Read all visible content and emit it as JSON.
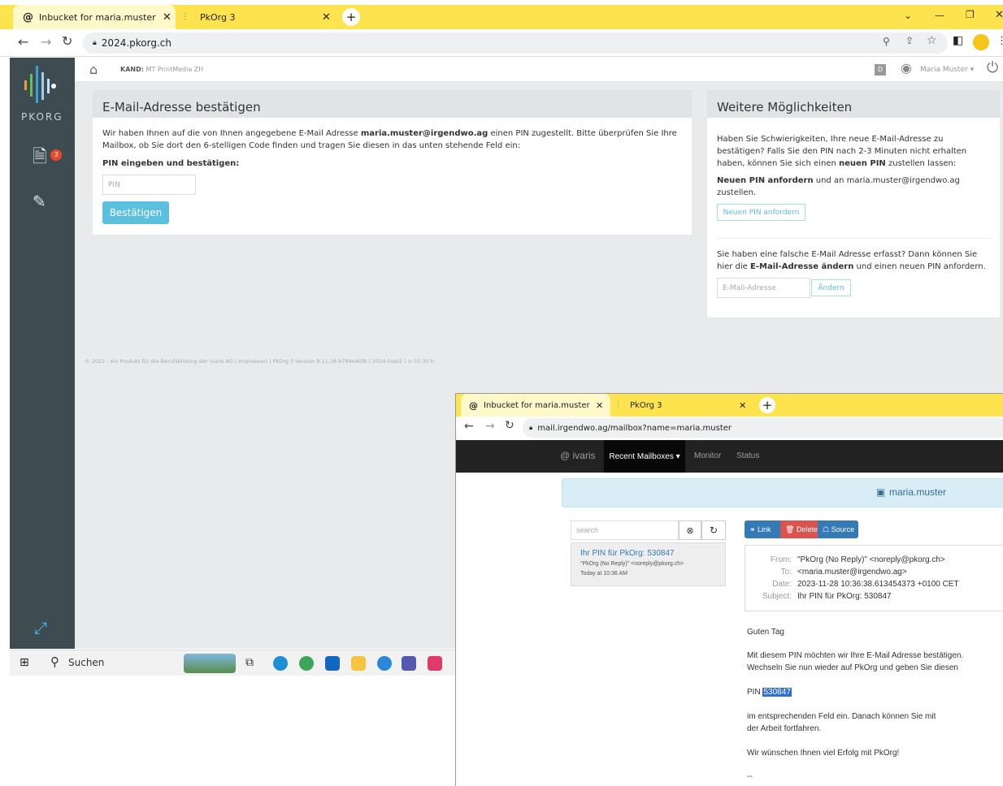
{
  "browser": {
    "tabs": [
      {
        "label": "Inbucket for maria.muster",
        "active": true
      },
      {
        "label": "PkOrg 3",
        "active": false
      }
    ],
    "url": "2024.pkorg.ch"
  },
  "app": {
    "brand": "PKORG",
    "badge_count": "3",
    "breadcrumb_label": "KAND:",
    "breadcrumb_value": "MT PrintMedia ZH",
    "user_initial": "D",
    "user_name": "Maria Muster"
  },
  "confirm_panel": {
    "title": "E-Mail-Adresse bestätigen",
    "text_before": "Wir haben Ihnen auf die von Ihnen angegebene E-Mail Adresse ",
    "email": "maria.muster@irgendwo.ag",
    "text_after": " einen PIN zugestellt. Bitte überprüfen Sie Ihre",
    "text_line2": "Mailbox, ob Sie dort den 6-stelligen Code finden und tragen Sie diesen in das unten stehende Feld ein:",
    "pin_label": "PIN eingeben und bestätigen:",
    "pin_placeholder": "PIN",
    "confirm_button": "Bestätigen"
  },
  "more_panel": {
    "title": "Weitere Möglichkeiten",
    "p1_line1": "Haben Sie Schwierigkeiten, Ihre neue E-Mail-Adresse zu",
    "p1_line2": "bestätigen? Falls Sie den PIN nach 2-3 Minuten nicht erhalten",
    "p1_line3a": "haben, können Sie sich einen ",
    "p1_line3b": "neuen PIN",
    "p1_line3c": " zustellen lassen:",
    "p2_line1a": "Neuen PIN anfordern",
    "p2_line1b": " und an maria.muster@irgendwo.ag",
    "p2_line2": "zustellen.",
    "new_pin_button": "Neuen PIN anfordern",
    "p3_line1": "Sie haben eine falsche E-Mail Adresse erfasst? Dann können Sie",
    "p3_line2a": "hier die ",
    "p3_line2b": "E-Mail-Adresse ändern",
    "p3_line2c": " und einen neuen PIN anfordern.",
    "email_placeholder": "E-Mail-Adresse",
    "change_button": "Ändern"
  },
  "footer": "© 2022 - ein Produkt für die Berufsbildung der Ivaris AG | Impressum | PkOrg 3 Version 9.11.28-b784e40fb | 2024-host2 | ⊙ 01:30 h",
  "taskbar": {
    "search_label": "Suchen"
  },
  "popup": {
    "tabs": [
      {
        "label": "Inbucket for maria.muster"
      },
      {
        "label": "PkOrg 3"
      }
    ],
    "url": "mail.irgendwo.ag/mailbox?name=maria.muster",
    "nav": {
      "brand": "ivaris",
      "recent": "Recent Mailboxes",
      "monitor": "Monitor",
      "status": "Status"
    },
    "mailbox_name": "maria.muster",
    "search_placeholder": "search",
    "message": {
      "subject": "Ihr PIN für PkOrg: 530847",
      "from_line": "\"PkOrg (No Reply)\" <noreply@pkorg.ch>",
      "date_line": "Today at 10:36 AM"
    },
    "buttons": {
      "link": "Link",
      "delete": "Delete",
      "source": "Source"
    },
    "headers": {
      "from_label": "From:",
      "from": "\"PkOrg (No Reply)\" <noreply@pkorg.ch>",
      "to_label": "To:",
      "to": "<maria.muster@irgendwo.ag>",
      "date_label": "Date:",
      "date": "2023-11-28 10:36:38.613454373 +0100 CET",
      "subject_label": "Subject:",
      "subject": "Ihr PIN für PkOrg: 530847"
    },
    "body": {
      "greeting": "Guten Tag",
      "line1": "Mit diesem PIN möchten wir Ihre E-Mail Adresse bestätigen.",
      "line2": "Wechseln Sie nun wieder auf PkOrg und geben Sie diesen",
      "pin_label": "PIN",
      "pin": "530847",
      "line3": "im entsprechenden Feld ein. Danach können Sie mit",
      "line4": "der Arbeit fortfahren.",
      "closing": "Wir wünschen Ihnen viel Erfolg mit PkOrg!",
      "sig": "--"
    }
  }
}
